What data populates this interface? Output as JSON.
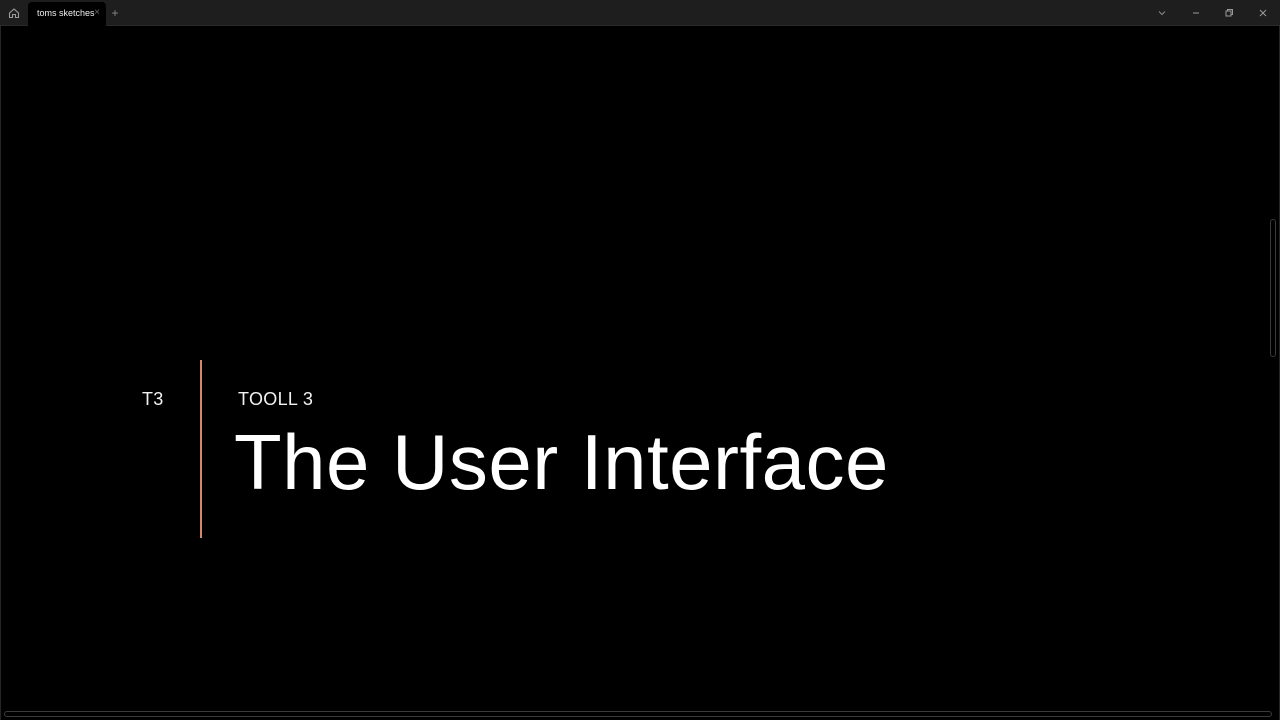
{
  "window": {
    "tab_label": "toms sketches",
    "tab_close_glyph": "×",
    "new_tab_glyph": "+",
    "icons": {
      "home": "home-icon",
      "tab_list": "chevron-down-icon",
      "minimize": "minimize-icon",
      "maximize": "restore-icon",
      "close": "close-icon"
    }
  },
  "slide": {
    "brand": "T3",
    "subtitle": "TOOLL 3",
    "headline": "The User Interface",
    "accent_color": "#d4896a",
    "background": "#000000"
  }
}
